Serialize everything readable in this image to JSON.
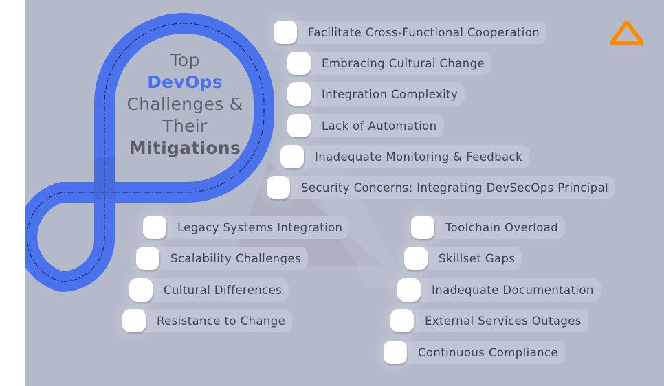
{
  "title": {
    "line1": "Top",
    "line2": "DevOps",
    "line3": "Challenges &",
    "line4": "Their",
    "line5": "Mitigations"
  },
  "colors": {
    "background": "#b5bacb",
    "road": "#4a72ec",
    "accent_text": "#4a72ec",
    "title_text": "#5b5f6b",
    "pill": "#c0c5d6",
    "item_text": "#3f4350",
    "logo": "#ff8a00"
  },
  "logo": {
    "icon": "triangle-logo-icon"
  },
  "top_group": [
    {
      "label": "Facilitate Cross-Functional Cooperation"
    },
    {
      "label": "Embracing Cultural Change"
    },
    {
      "label": "Integration Complexity"
    },
    {
      "label": "Lack of Automation"
    },
    {
      "label": "Inadequate Monitoring & Feedback"
    },
    {
      "label": "Security Concerns: Integrating DevSecOps Principal"
    }
  ],
  "left_group": [
    {
      "label": "Legacy Systems Integration"
    },
    {
      "label": "Scalability Challenges"
    },
    {
      "label": "Cultural Differences"
    },
    {
      "label": "Resistance to Change"
    }
  ],
  "right_group": [
    {
      "label": "Toolchain Overload"
    },
    {
      "label": "Skillset Gaps"
    },
    {
      "label": "Inadequate Documentation"
    },
    {
      "label": "External Services Outages"
    },
    {
      "label": "Continuous Compliance"
    }
  ]
}
